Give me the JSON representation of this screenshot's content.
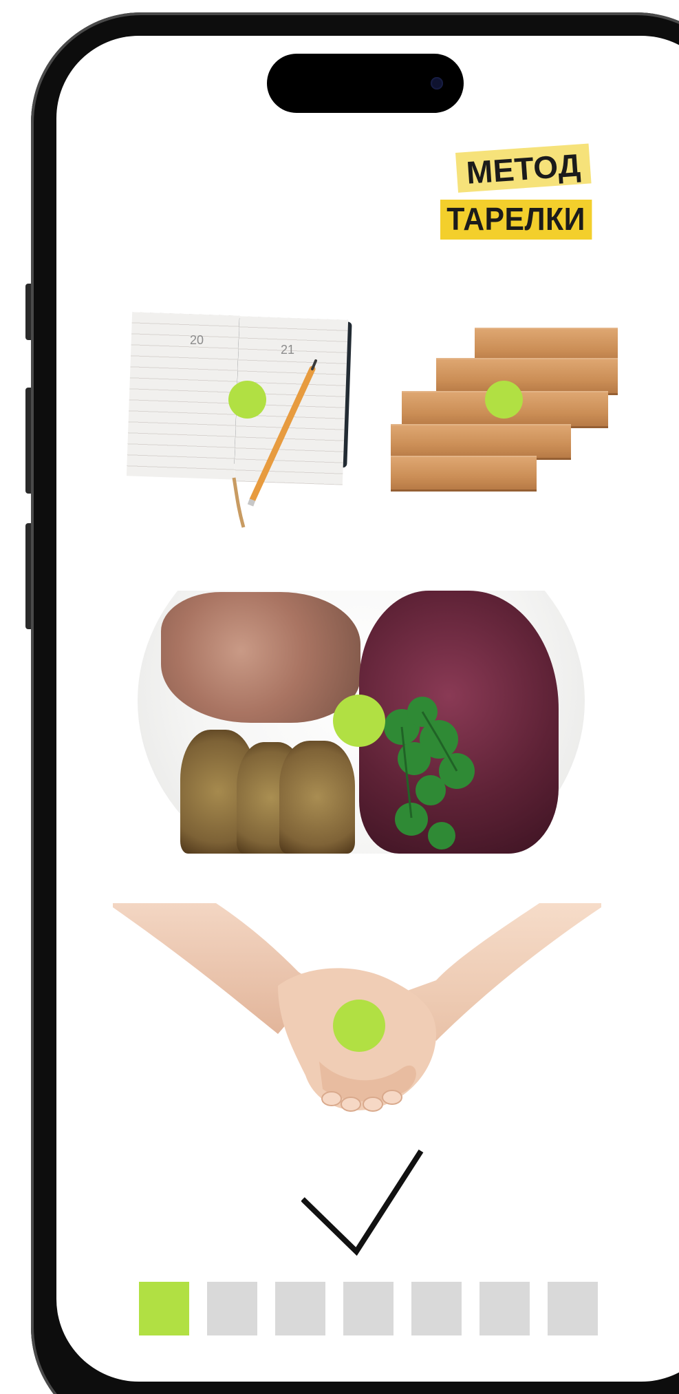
{
  "logo": {
    "line1": "МЕТОД",
    "line2": "ТАРЕЛКИ"
  },
  "diary": {
    "left_page_number": "20",
    "right_page_number": "21"
  },
  "progress": {
    "total_steps": 7,
    "current_step": 1
  },
  "icons": {
    "check": "checkmark-icon",
    "marker": "hotspot-dot"
  },
  "colors": {
    "accent": "#b1e043",
    "inactive": "#d9d9d9",
    "logo_yellow": "#f3cf2c",
    "logo_light_yellow": "#f6e27a",
    "frame": "#0d0d0d"
  }
}
